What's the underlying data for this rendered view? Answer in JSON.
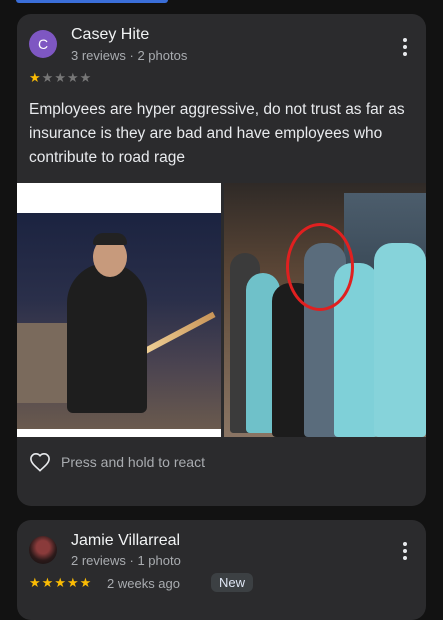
{
  "reviews": [
    {
      "avatar_letter": "C",
      "name": "Casey Hite",
      "meta": "3 reviews · 2 photos",
      "rating": 1,
      "text": "Employees are hyper aggressive, do not trust as far as insurance is they are bad and have employees who contribute to road rage",
      "react_label": "Press and hold to react"
    },
    {
      "name": "Jamie Villarreal",
      "meta": "2 reviews · 1 photo",
      "rating": 5,
      "when": "2 weeks ago",
      "badge": "New"
    }
  ],
  "colors": {
    "star_on": "#fbbc04",
    "star_off": "#777777",
    "card_bg": "#2b2b2d",
    "page_bg": "#121212",
    "avatar_c": "#7e57c2",
    "circle_annotation": "#e02020"
  },
  "icons": {
    "more": "kebab-menu-icon",
    "react": "heart-outline-icon",
    "star": "star-icon"
  }
}
